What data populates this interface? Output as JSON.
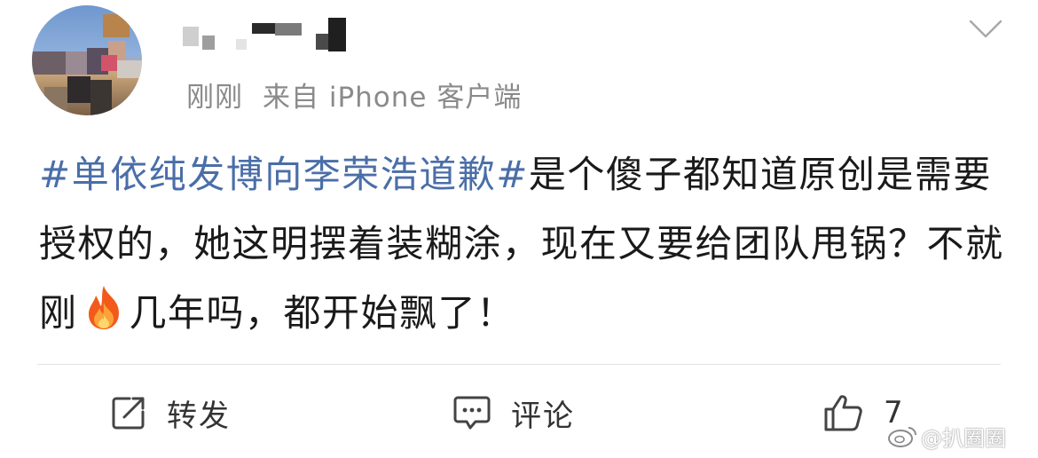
{
  "post": {
    "author_name": "",
    "time": "刚刚",
    "source": "来自 iPhone 客户端",
    "hashtag": "#单依纯发博向李荣浩道歉#",
    "body_part1": "是个傻子都知道原创是需要授权的，她这明摆着装糊涂，现在又要给团队甩锅？不就刚",
    "emoji": "fire-emoji",
    "body_part2": "几年吗，都开始飘了！"
  },
  "actions": {
    "repost_label": "转发",
    "comment_label": "评论",
    "like_count": "7"
  },
  "watermark": {
    "text": "@扒圈圈"
  },
  "colors": {
    "hashtag": "#4a6ea8",
    "meta_text": "#8a8a8a",
    "body_text": "#1a1a1a",
    "divider": "#e3e3e3"
  },
  "icons": [
    "chevron-down-icon",
    "repost-icon",
    "comment-icon",
    "like-icon",
    "fire-emoji",
    "weibo-logo"
  ]
}
